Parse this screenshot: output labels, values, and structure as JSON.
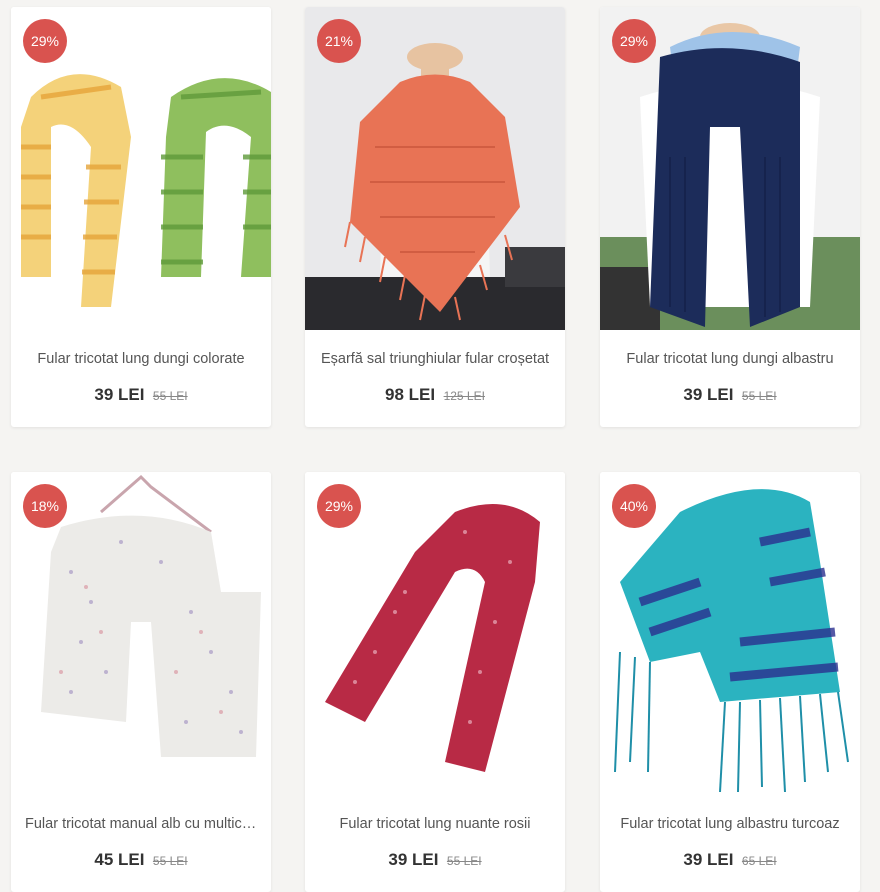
{
  "products": [
    {
      "discount": "29%",
      "title": "Fular tricotat lung dungi colorate",
      "price": "39 LEI",
      "old_price": "55 LEI"
    },
    {
      "discount": "21%",
      "title": "Eșarfă sal triunghiular fular croșetat",
      "price": "98 LEI",
      "old_price": "125 LEI"
    },
    {
      "discount": "29%",
      "title": "Fular tricotat lung dungi albastru",
      "price": "39 LEI",
      "old_price": "55 LEI"
    },
    {
      "discount": "18%",
      "title": "Fular tricotat manual alb cu multicolor",
      "price": "45 LEI",
      "old_price": "55 LEI"
    },
    {
      "discount": "29%",
      "title": "Fular tricotat lung nuante rosii",
      "price": "39 LEI",
      "old_price": "55 LEI"
    },
    {
      "discount": "40%",
      "title": "Fular tricotat lung albastru turcoaz",
      "price": "39 LEI",
      "old_price": "65 LEI"
    }
  ],
  "colors": {
    "badge": "#d9534f",
    "background": "#f5f4f2"
  }
}
